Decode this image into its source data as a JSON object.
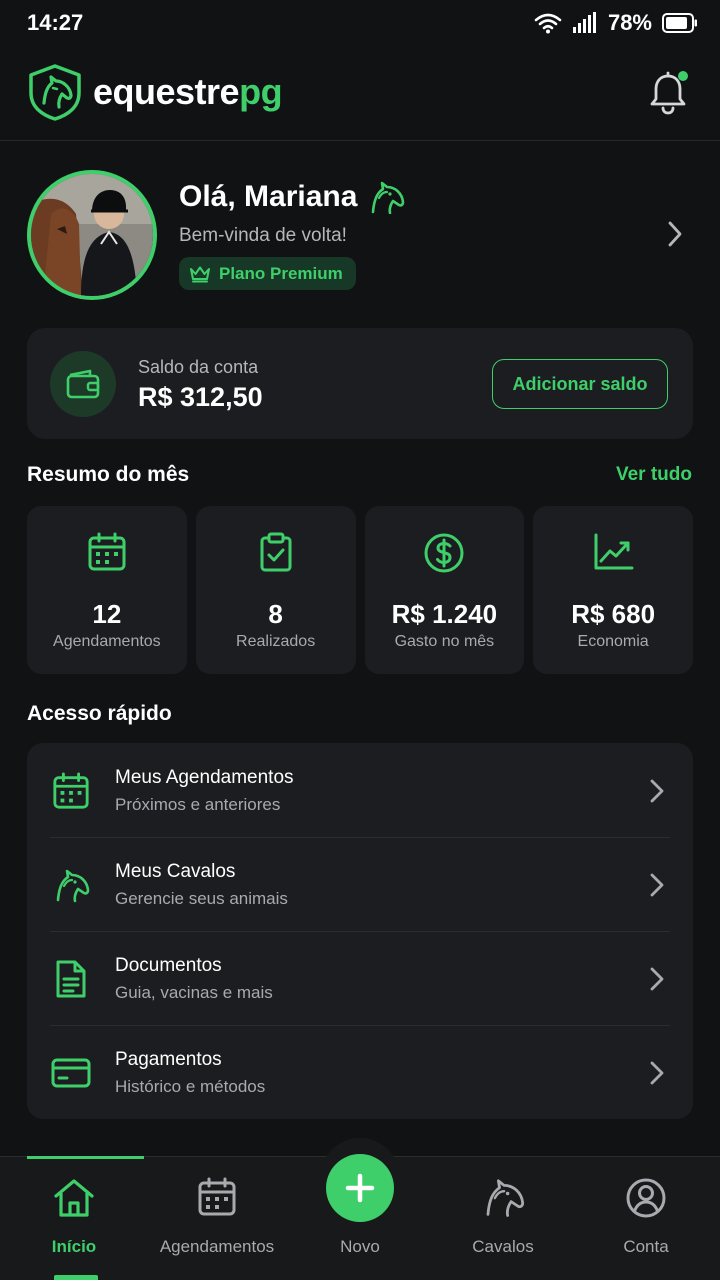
{
  "status_bar": {
    "time": "14:27",
    "battery": "78%"
  },
  "header": {
    "brand_main": "equestre",
    "brand_accent": "pg",
    "has_notification": true
  },
  "profile": {
    "greeting": "Olá, Mariana",
    "subtitle": "Bem-vinda de volta!",
    "plan": "Plano Premium"
  },
  "balance": {
    "label": "Saldo da conta",
    "value": "R$ 312,50",
    "button": "Adicionar saldo"
  },
  "summary": {
    "title": "Resumo do mês",
    "see_all": "Ver tudo",
    "stats": [
      {
        "icon": "calendar-icon",
        "value": "12",
        "label": "Agendamentos"
      },
      {
        "icon": "clipboard-check-icon",
        "value": "8",
        "label": "Realizados"
      },
      {
        "icon": "dollar-icon",
        "value": "R$ 1.240",
        "label": "Gasto no mês"
      },
      {
        "icon": "trend-up-icon",
        "value": "R$ 680",
        "label": "Economia"
      }
    ]
  },
  "quick_access": {
    "title": "Acesso rápido",
    "items": [
      {
        "icon": "calendar-icon",
        "title": "Meus Agendamentos",
        "subtitle": "Próximos e anteriores"
      },
      {
        "icon": "horse-icon",
        "title": "Meus Cavalos",
        "subtitle": "Gerencie seus animais"
      },
      {
        "icon": "document-icon",
        "title": "Documentos",
        "subtitle": "Guia, vacinas e mais"
      },
      {
        "icon": "card-icon",
        "title": "Pagamentos",
        "subtitle": "Histórico e métodos"
      }
    ]
  },
  "bottom_nav": {
    "items": [
      {
        "icon": "home-icon",
        "label": "Início",
        "active": true
      },
      {
        "icon": "calendar-icon",
        "label": "Agendamentos",
        "active": false
      },
      {
        "icon": "plus-icon",
        "label": "Novo",
        "active": false
      },
      {
        "icon": "horse-icon",
        "label": "Cavalos",
        "active": false
      },
      {
        "icon": "user-icon",
        "label": "Conta",
        "active": false
      }
    ]
  },
  "colors": {
    "accent": "#3fcf6a",
    "background": "#111214",
    "card": "#1c1d20"
  }
}
